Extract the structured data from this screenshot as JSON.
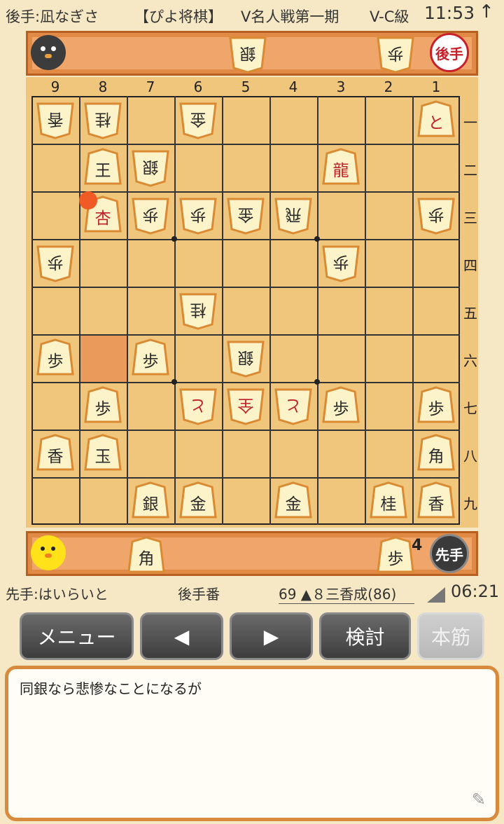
{
  "header": {
    "gote_player": "後手:凪なぎさ",
    "app_name": "【ぴよ将棋】",
    "event": "V名人戦第一期",
    "rank": "V-C級",
    "clock": "11:53"
  },
  "board": {
    "col_labels": [
      "9",
      "8",
      "7",
      "6",
      "5",
      "4",
      "3",
      "2",
      "1"
    ],
    "row_labels": [
      "一",
      "二",
      "三",
      "四",
      "五",
      "六",
      "七",
      "八",
      "九"
    ],
    "pieces": [
      {
        "col": 9,
        "row": 1,
        "ch": "香",
        "side": "gote",
        "promoted": false
      },
      {
        "col": 8,
        "row": 1,
        "ch": "桂",
        "side": "gote",
        "promoted": false
      },
      {
        "col": 6,
        "row": 1,
        "ch": "金",
        "side": "gote",
        "promoted": false
      },
      {
        "col": 1,
        "row": 1,
        "ch": "と",
        "side": "sente",
        "promoted": true
      },
      {
        "col": 8,
        "row": 2,
        "ch": "王",
        "side": "sente",
        "promoted": false
      },
      {
        "col": 7,
        "row": 2,
        "ch": "銀",
        "side": "gote",
        "promoted": false
      },
      {
        "col": 3,
        "row": 2,
        "ch": "龍",
        "side": "sente",
        "promoted": true
      },
      {
        "col": 8,
        "row": 3,
        "ch": "杏",
        "side": "sente",
        "promoted": true
      },
      {
        "col": 7,
        "row": 3,
        "ch": "歩",
        "side": "gote",
        "promoted": false
      },
      {
        "col": 6,
        "row": 3,
        "ch": "歩",
        "side": "gote",
        "promoted": false
      },
      {
        "col": 5,
        "row": 3,
        "ch": "金",
        "side": "gote",
        "promoted": false
      },
      {
        "col": 4,
        "row": 3,
        "ch": "飛",
        "side": "gote",
        "promoted": false
      },
      {
        "col": 1,
        "row": 3,
        "ch": "歩",
        "side": "gote",
        "promoted": false
      },
      {
        "col": 9,
        "row": 4,
        "ch": "歩",
        "side": "gote",
        "promoted": false
      },
      {
        "col": 3,
        "row": 4,
        "ch": "歩",
        "side": "gote",
        "promoted": false
      },
      {
        "col": 6,
        "row": 5,
        "ch": "桂",
        "side": "gote",
        "promoted": false
      },
      {
        "col": 9,
        "row": 6,
        "ch": "歩",
        "side": "sente",
        "promoted": false
      },
      {
        "col": 7,
        "row": 6,
        "ch": "歩",
        "side": "sente",
        "promoted": false
      },
      {
        "col": 5,
        "row": 6,
        "ch": "銀",
        "side": "gote",
        "promoted": false
      },
      {
        "col": 8,
        "row": 7,
        "ch": "歩",
        "side": "sente",
        "promoted": false
      },
      {
        "col": 6,
        "row": 7,
        "ch": "と",
        "side": "gote",
        "promoted": true
      },
      {
        "col": 5,
        "row": 7,
        "ch": "全",
        "side": "gote",
        "promoted": true
      },
      {
        "col": 4,
        "row": 7,
        "ch": "と",
        "side": "gote",
        "promoted": true
      },
      {
        "col": 3,
        "row": 7,
        "ch": "歩",
        "side": "sente",
        "promoted": false
      },
      {
        "col": 1,
        "row": 7,
        "ch": "歩",
        "side": "sente",
        "promoted": false
      },
      {
        "col": 9,
        "row": 8,
        "ch": "香",
        "side": "sente",
        "promoted": false
      },
      {
        "col": 8,
        "row": 8,
        "ch": "玉",
        "side": "sente",
        "promoted": false
      },
      {
        "col": 1,
        "row": 8,
        "ch": "角",
        "side": "sente",
        "promoted": false
      },
      {
        "col": 7,
        "row": 9,
        "ch": "銀",
        "side": "sente",
        "promoted": false
      },
      {
        "col": 6,
        "row": 9,
        "ch": "金",
        "side": "sente",
        "promoted": false
      },
      {
        "col": 4,
        "row": 9,
        "ch": "金",
        "side": "sente",
        "promoted": false
      },
      {
        "col": 2,
        "row": 9,
        "ch": "桂",
        "side": "sente",
        "promoted": false
      },
      {
        "col": 1,
        "row": 9,
        "ch": "香",
        "side": "sente",
        "promoted": false
      }
    ],
    "last_move_from": {
      "col": 8,
      "row": 6
    },
    "last_move_to": {
      "col": 8,
      "row": 3
    }
  },
  "gote_hand": {
    "pieces": [
      {
        "ch": "銀",
        "count": 1
      },
      {
        "ch": "歩",
        "count": 1
      }
    ],
    "badge": "後手"
  },
  "sente_hand": {
    "pieces": [
      {
        "ch": "角",
        "count": 1
      },
      {
        "ch": "歩",
        "count": 4
      }
    ],
    "pawn_count": "4",
    "badge": "先手"
  },
  "status": {
    "sente_player": "先手:はいらいと",
    "turn": "後手番",
    "move": "69 ▲８三香成(86)",
    "time": "06:21"
  },
  "buttons": {
    "menu": "メニュー",
    "prev": "◀",
    "next": "▶",
    "analyze": "検討",
    "mainline": "本筋"
  },
  "comment": {
    "text": "同銀なら悲惨なことになるが"
  },
  "colors": {
    "accent": "#e08a45",
    "red_piece": "#c0202a",
    "last_move_dot": "#f05a24"
  }
}
